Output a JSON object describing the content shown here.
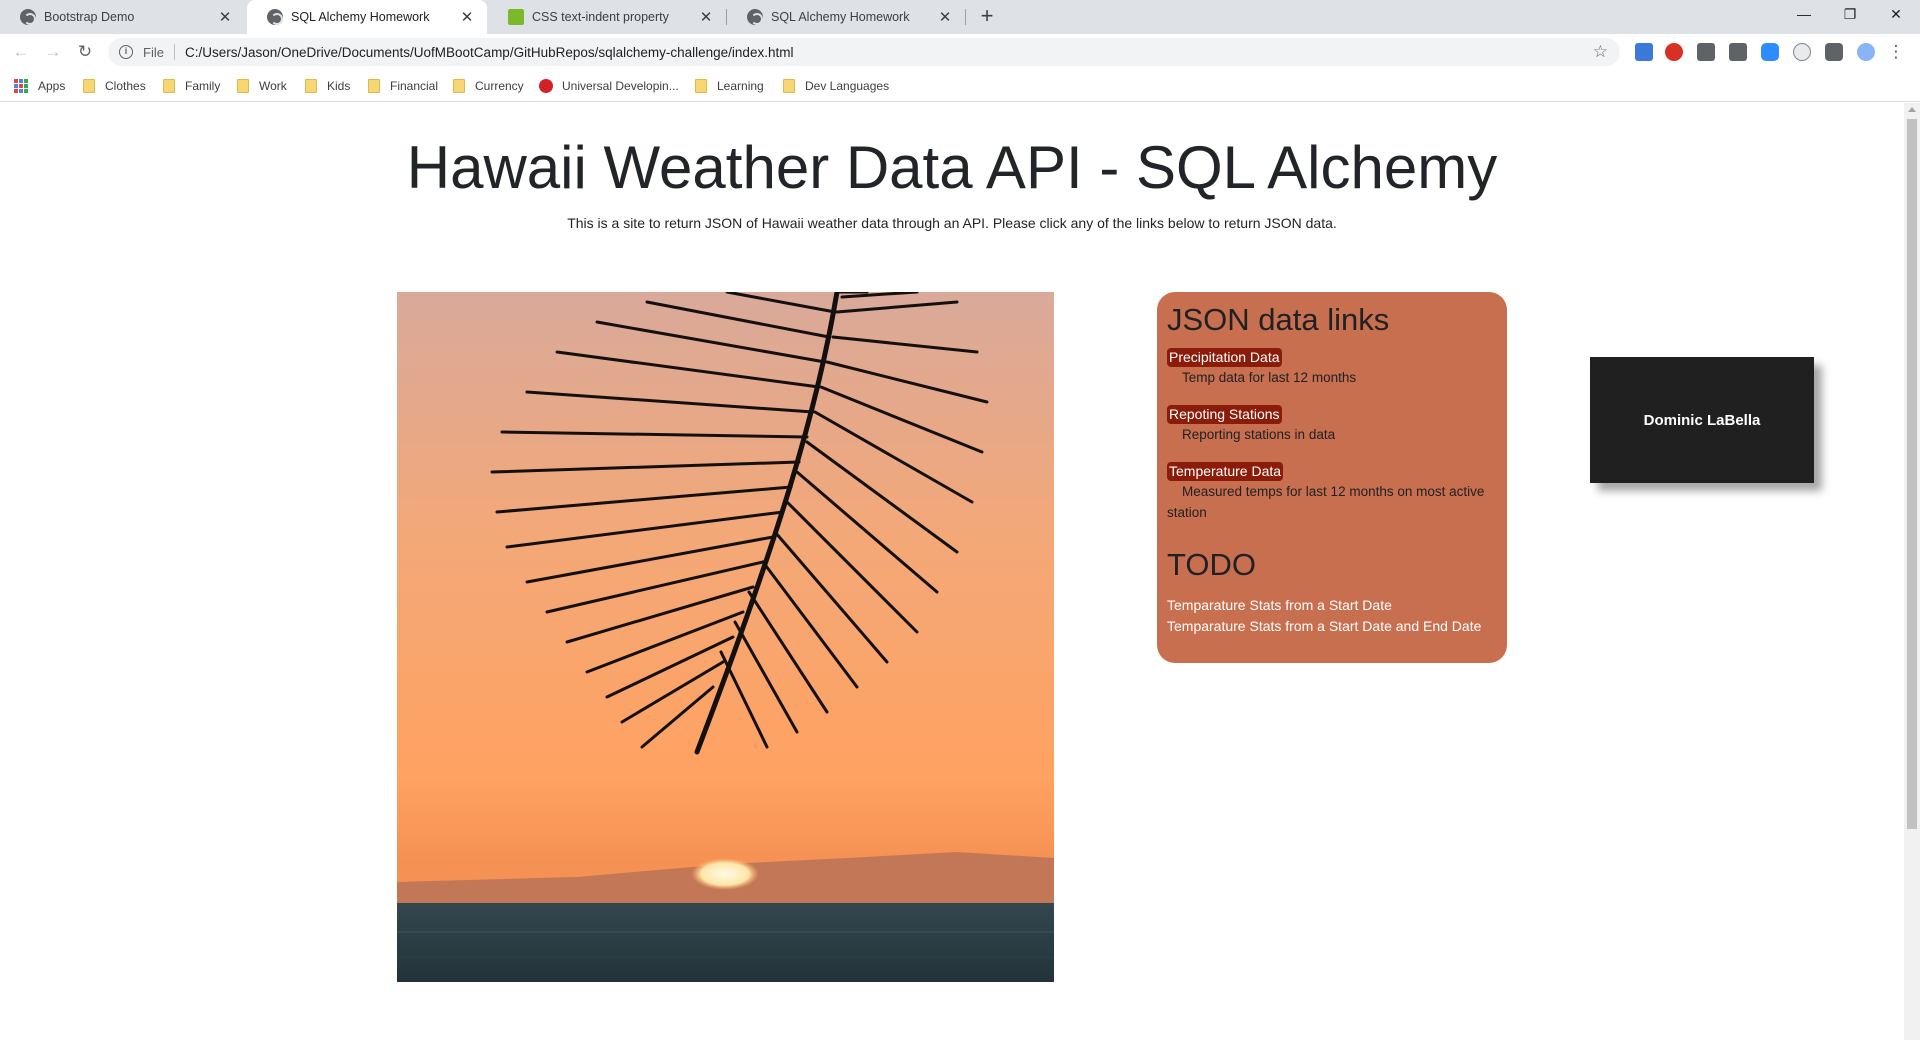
{
  "browser": {
    "tabs": [
      {
        "title": "Bootstrap Demo",
        "active": false
      },
      {
        "title": "SQL Alchemy Homework",
        "active": true
      },
      {
        "title": "CSS text-indent property",
        "active": false
      },
      {
        "title": "SQL Alchemy Homework",
        "active": false
      }
    ],
    "new_tab_icon": "plus-icon",
    "window_controls": [
      "minimize-icon",
      "restore-icon",
      "close-icon"
    ],
    "omnibox": {
      "scheme_label": "File",
      "url": "C:/Users/Jason/OneDrive/Documents/UofMBootCamp/GitHubRepos/sqlalchemy-challenge/index.html"
    },
    "bookmarks": [
      {
        "label": "Apps",
        "icon": "apps-grid-icon"
      },
      {
        "label": "Clothes",
        "icon": "folder-icon"
      },
      {
        "label": "Family",
        "icon": "folder-icon"
      },
      {
        "label": "Work",
        "icon": "folder-icon"
      },
      {
        "label": "Kids",
        "icon": "folder-icon"
      },
      {
        "label": "Financial",
        "icon": "folder-icon"
      },
      {
        "label": "Currency",
        "icon": "folder-icon"
      },
      {
        "label": "Universal Developin...",
        "icon": "ud-logo-icon"
      },
      {
        "label": "Learning",
        "icon": "folder-icon"
      },
      {
        "label": "Dev Languages",
        "icon": "folder-icon"
      }
    ]
  },
  "page": {
    "title": "Hawaii Weather Data API - SQL Alchemy",
    "subtitle": "This is a site to return JSON of Hawaii weather data through an API. Please click any of the links below to return JSON data.",
    "links_card": {
      "heading": "JSON data links",
      "items": [
        {
          "label": "Precipitation Data",
          "description": "Temp data for last 12 months"
        },
        {
          "label": "Repoting Stations",
          "description": "Reporting stations in data"
        },
        {
          "label": "Temperature Data",
          "description": "Measured temps for last 12 months on most active station"
        }
      ],
      "todo_heading": "TODO",
      "todo_items": [
        "Temparature Stats from a Start Date",
        "Temparature Stats from a Start Date and End Date"
      ]
    },
    "name_card": "Dominic LaBella"
  },
  "colors": {
    "card_bg": "#c86f4f",
    "link_bg": "#8b1c0a",
    "name_card_bg": "#202020"
  }
}
